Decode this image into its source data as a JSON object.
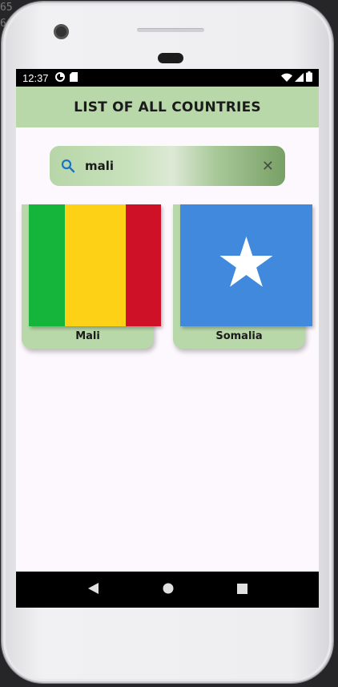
{
  "background_code": [
    "65",
    "6"
  ],
  "status_bar": {
    "time": "12:37"
  },
  "app_bar": {
    "title": "LIST OF ALL COUNTRIES"
  },
  "search": {
    "value": "mali",
    "icon": "search-icon",
    "clear_icon": "close-icon"
  },
  "countries": [
    {
      "name": "Mali",
      "flag_colors": [
        "#14b53a",
        "#fcd116",
        "#ce1126"
      ]
    },
    {
      "name": "Somalia",
      "flag_colors": [
        "#4189dd",
        "#ffffff"
      ]
    }
  ],
  "nav": {
    "back_icon": "back-icon",
    "home_icon": "home-icon",
    "recents_icon": "recents-icon"
  },
  "colors": {
    "primary": "#b8d8a9",
    "screen_bg": "#fdf8fd"
  }
}
